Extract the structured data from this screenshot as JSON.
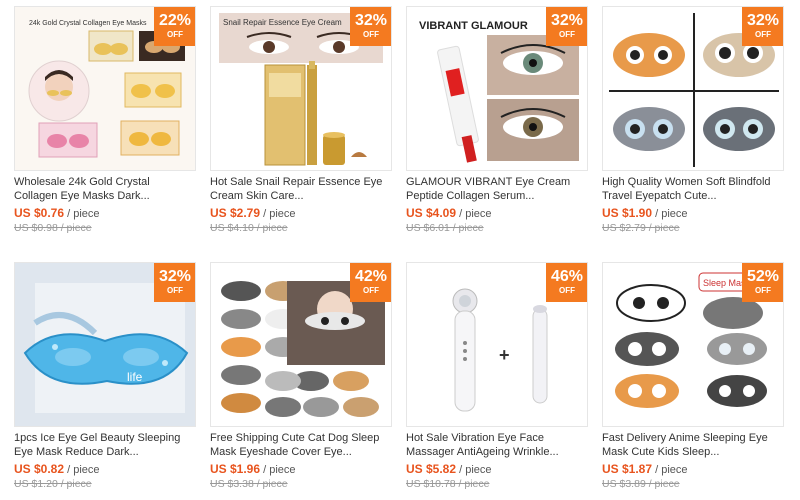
{
  "colors": {
    "badge": "#f47a20",
    "price": "#e8541e",
    "old_price": "#999999"
  },
  "products": [
    {
      "discount": "22%",
      "off_label": "OFF",
      "image_text": "24k Gold Crystal Collagen Eye Masks",
      "title": "Wholesale 24k Gold Crystal Collagen Eye Masks Dark...",
      "price": "US $0.76",
      "unit": "/ piece",
      "old_price": "US $0.98 / piece"
    },
    {
      "discount": "32%",
      "off_label": "OFF",
      "image_text": "Snail Repair Essence Eye Cream",
      "title": "Hot Sale Snail Repair Essence Eye Cream Skin Care...",
      "price": "US $2.79",
      "unit": "/ piece",
      "old_price": "US $4.10 / piece"
    },
    {
      "discount": "32%",
      "off_label": "OFF",
      "image_text": "VIBRANT GLAMOUR",
      "title": "GLAMOUR VIBRANT Eye Cream Peptide Collagen Serum...",
      "price": "US $4.09",
      "unit": "/ piece",
      "old_price": "US $6.01 / piece"
    },
    {
      "discount": "32%",
      "off_label": "OFF",
      "title": "High Quality Women Soft Blindfold Travel Eyepatch Cute...",
      "price": "US $1.90",
      "unit": "/ piece",
      "old_price": "US $2.79 / piece"
    },
    {
      "discount": "32%",
      "off_label": "OFF",
      "image_text": "life",
      "title": "1pcs Ice Eye Gel Beauty Sleeping Eye Mask Reduce Dark...",
      "price": "US $0.82",
      "unit": "/ piece",
      "old_price": "US $1.20 / piece"
    },
    {
      "discount": "42%",
      "off_label": "OFF",
      "title": "Free Shipping Cute Cat Dog Sleep Mask Eyeshade Cover Eye...",
      "price": "US $1.96",
      "unit": "/ piece",
      "old_price": "US $3.38 / piece"
    },
    {
      "discount": "46%",
      "off_label": "OFF",
      "image_text": "+",
      "title": "Hot Sale Vibration Eye Face Massager AntiAgeing Wrinkle...",
      "price": "US $5.82",
      "unit": "/ piece",
      "old_price": "US $10.78 / piece"
    },
    {
      "discount": "52%",
      "off_label": "OFF",
      "image_text": "Sleep Mask",
      "title": "Fast Delivery Anime Sleeping Eye Mask Cute Kids Sleep...",
      "price": "US $1.87",
      "unit": "/ piece",
      "old_price": "US $3.89 / piece"
    }
  ]
}
